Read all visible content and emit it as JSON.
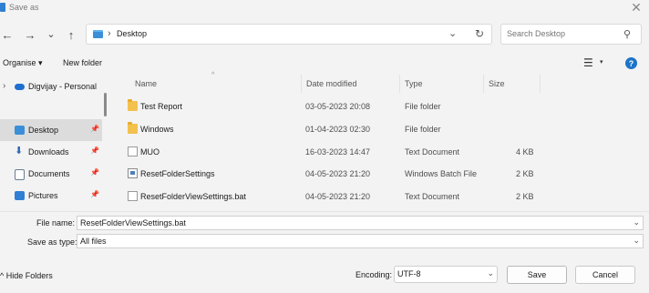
{
  "window": {
    "title": "Save as",
    "close_glyph": "✕"
  },
  "nav": {
    "back_glyph": "←",
    "forward_glyph": "→",
    "recent_glyph": "⌄",
    "up_glyph": "↑",
    "breadcrumb": "Desktop",
    "breadcrumb_sep": "›",
    "dropdown_glyph": "⌄",
    "refresh_glyph": "↻",
    "search_placeholder": "Search Desktop",
    "search_glyph": "⚲"
  },
  "toolbar": {
    "organise_label": "Organise ▾",
    "new_folder_label": "New folder",
    "view_glyph": "☰",
    "view_dd_glyph": "▾",
    "help_glyph": "?"
  },
  "sidebar": {
    "items": [
      {
        "label": "Digvijay - Personal",
        "icon": "cloud-icon",
        "color": "#1f6fd1",
        "chevron": "›"
      },
      {
        "label": "Desktop",
        "icon": "desktop-icon",
        "color": "#3a8fd8",
        "pin": "📌"
      },
      {
        "label": "Downloads",
        "icon": "downloads-icon",
        "color": "#2e8b57",
        "pin": "📌"
      },
      {
        "label": "Documents",
        "icon": "documents-icon",
        "color": "#6b7c93",
        "pin": "📌"
      },
      {
        "label": "Pictures",
        "icon": "pictures-icon",
        "color": "#2f7fd3",
        "pin": "📌"
      }
    ]
  },
  "table": {
    "sort_glyph": "^",
    "headers": {
      "name": "Name",
      "date": "Date modified",
      "type": "Type",
      "size": "Size"
    },
    "rows": [
      {
        "name": "Test Report",
        "date": "03-05-2023 20:08",
        "type": "File folder",
        "size": "",
        "kind": "folder"
      },
      {
        "name": "Windows",
        "date": "01-04-2023 02:30",
        "type": "File folder",
        "size": "",
        "kind": "folder"
      },
      {
        "name": "MUO",
        "date": "16-03-2023 14:47",
        "type": "Text Document",
        "size": "4 KB",
        "kind": "doc"
      },
      {
        "name": "ResetFolderSettings",
        "date": "04-05-2023 21:20",
        "type": "Windows Batch File",
        "size": "2 KB",
        "kind": "bat"
      },
      {
        "name": "ResetFolderViewSettings.bat",
        "date": "04-05-2023 21:20",
        "type": "Text Document",
        "size": "2 KB",
        "kind": "doc"
      }
    ]
  },
  "save": {
    "file_name_label": "File name:",
    "file_name_value": "ResetFolderViewSettings.bat",
    "save_type_label": "Save as type:",
    "save_type_value": "All files",
    "dd_glyph": "⌄"
  },
  "footer": {
    "hide_folders_label": "^ Hide Folders",
    "encoding_label": "Encoding:",
    "encoding_value": "UTF-8",
    "save_label": "Save",
    "cancel_label": "Cancel"
  }
}
